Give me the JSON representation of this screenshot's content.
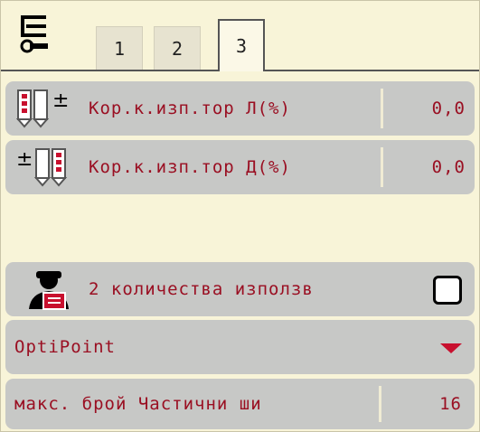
{
  "tabs": [
    {
      "label": "1"
    },
    {
      "label": "2"
    },
    {
      "label": "3"
    }
  ],
  "active_tab": "3",
  "rows": {
    "left_correction": {
      "label": "Кор.к.изп.тор Л(%)",
      "value": "0,0"
    },
    "right_correction": {
      "label": "Кор.к.изп.тор Д(%)",
      "value": "0,0"
    },
    "two_quantities": {
      "label": "2 количества използв",
      "checked": false
    },
    "optipoint": {
      "label": "OptiPoint"
    },
    "max_sections": {
      "label": "макс. брой Частични ши",
      "value": "16"
    }
  },
  "colors": {
    "background": "#f7f3d6",
    "row": "#c7c8c6",
    "text": "#9a0f22",
    "accent": "#c8102e"
  },
  "icons": {
    "tools": "tools-settings-icon",
    "left_correction": "left-spread-correction-icon",
    "right_correction": "right-spread-correction-icon",
    "operator": "operator-icon"
  }
}
